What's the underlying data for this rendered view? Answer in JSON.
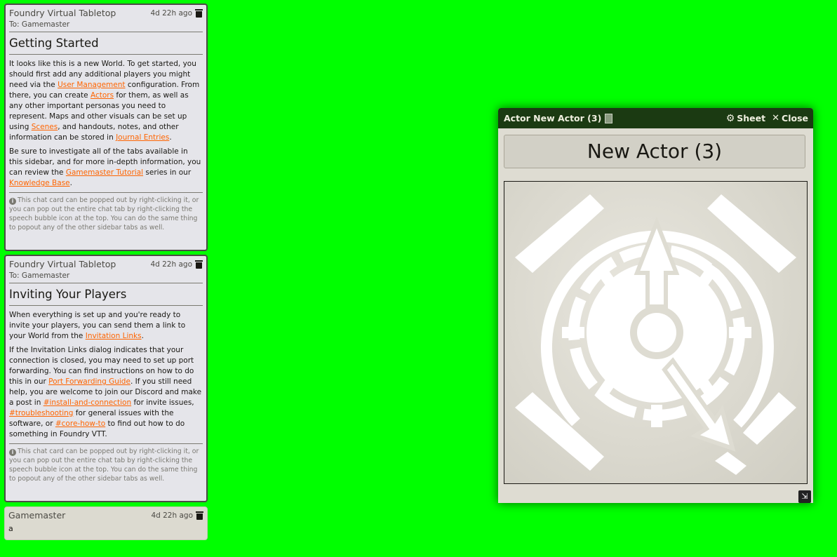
{
  "chat": [
    {
      "sender": "Foundry Virtual Tabletop",
      "timestamp": "4d 22h ago",
      "whisper": "To: Gamemaster",
      "title": "Getting Started",
      "p1": {
        "t1": "It looks like this is a new World. To get started, you should first add any additional players you might need via the ",
        "l1": "User Management",
        "t2": " configuration. From there, you can create ",
        "l2": "Actors",
        "t3": " for them, as well as any other important personas you need to represent. Maps and other visuals can be set up using ",
        "l3": "Scenes",
        "t4": ", and handouts, notes, and other information can be stored in ",
        "l4": "Journal Entries",
        "t5": "."
      },
      "p2": {
        "t1": "Be sure to investigate all of the tabs available in this sidebar, and for more in-depth information, you can review the ",
        "l1": "Gamemaster Tutorial",
        "t2": " series in our ",
        "l2": "Knowledge Base",
        "t3": "."
      },
      "hint": "This chat card can be popped out by right-clicking it, or you can pop out the entire chat tab by right-clicking the speech bubble icon at the top. You can do the same thing to popout any of the other sidebar tabs as well."
    },
    {
      "sender": "Foundry Virtual Tabletop",
      "timestamp": "4d 22h ago",
      "whisper": "To: Gamemaster",
      "title": "Inviting Your Players",
      "p1": {
        "t1": "When everything is set up and you're ready to invite your players, you can send them a link to your World from the ",
        "l1": "Invitation Links",
        "t2": "."
      },
      "p2": {
        "t1": "If the Invitation Links dialog indicates that your connection is closed, you may need to set up port forwarding. You can find instructions on how to do this in our ",
        "l1": "Port Forwarding Guide",
        "t2": ". If you still need help, you are welcome to join our Discord and make a post in ",
        "l2": "#install-and-connection",
        "t3": " for invite issues, ",
        "l3": "#troubleshooting",
        "t4": " for general issues with the software, or ",
        "l4": "#core-how-to",
        "t5": " to find out how to do something in Foundry VTT."
      },
      "hint": "This chat card can be popped out by right-clicking it, or you can pop out the entire chat tab by right-clicking the speech bubble icon at the top. You can do the same thing to popout any of the other sidebar tabs as well."
    },
    {
      "sender": "Gamemaster",
      "timestamp": "4d 22h ago",
      "message": "a"
    }
  ],
  "sheet": {
    "window_title": "Actor New Actor (3)",
    "sheet_label": "Sheet",
    "close_label": "Close",
    "actor_name": "New Actor (3)"
  },
  "icons": {
    "delete": "trash-icon",
    "info": "info-circle-icon",
    "sheet": "gear-icon",
    "close": "close-icon",
    "resize": "resize-icon",
    "portrait": "mystery-man-token"
  },
  "colors": {
    "background": "#00ff00",
    "link": "#ff6400",
    "window_header": "#1b3a12"
  }
}
